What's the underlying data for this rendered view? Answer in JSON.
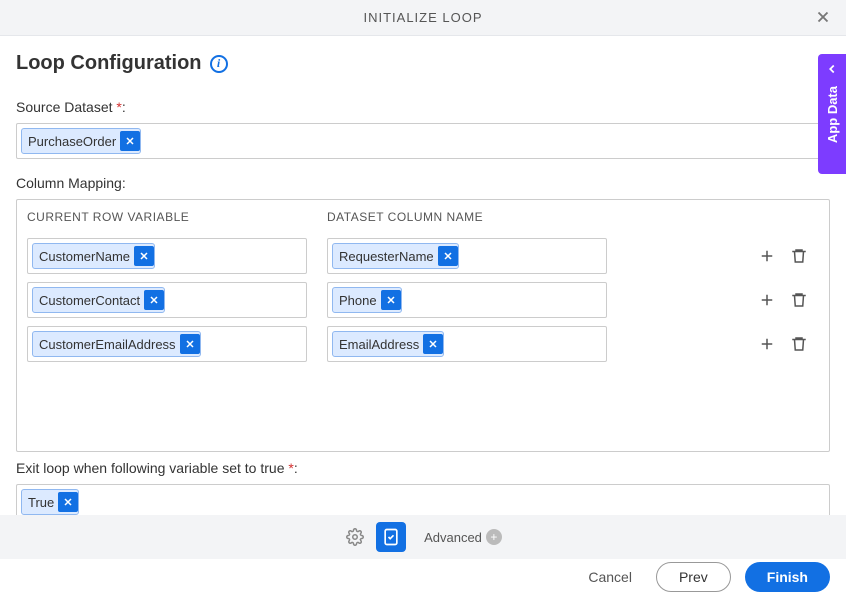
{
  "header": {
    "title": "INITIALIZE LOOP"
  },
  "section": {
    "title": "Loop Configuration"
  },
  "sourceDataset": {
    "label": "Source Dataset",
    "required": "*",
    "value": "PurchaseOrder"
  },
  "columnMapping": {
    "label": "Column Mapping:",
    "headers": {
      "variable": "CURRENT ROW VARIABLE",
      "dataset": "DATASET COLUMN NAME"
    },
    "rows": [
      {
        "variable": "CustomerName",
        "dataset": "RequesterName"
      },
      {
        "variable": "CustomerContact",
        "dataset": "Phone"
      },
      {
        "variable": "CustomerEmailAddress",
        "dataset": "EmailAddress"
      }
    ]
  },
  "exitLoop": {
    "label": "Exit loop when following variable set to true",
    "required": "*",
    "value": "True"
  },
  "footer": {
    "advanced": "Advanced"
  },
  "actions": {
    "cancel": "Cancel",
    "prev": "Prev",
    "finish": "Finish"
  },
  "sideTab": {
    "label": "App Data"
  }
}
